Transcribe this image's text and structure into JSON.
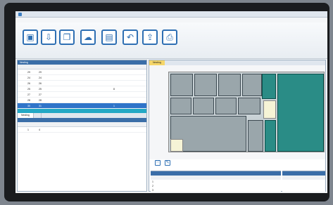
{
  "app": {
    "title": ""
  },
  "menu": {
    "items": [
      "",
      "",
      "",
      "",
      "",
      ""
    ]
  },
  "toolbar": {
    "buttons": [
      {
        "icon": "monitor-icon",
        "glyph": "▣",
        "label": ""
      },
      {
        "icon": "import-icon",
        "glyph": "⇩",
        "label": ""
      },
      {
        "icon": "folder-open-icon",
        "glyph": "❐",
        "label": ""
      },
      {
        "icon": "cloud-icon",
        "glyph": "☁",
        "label": ""
      },
      {
        "icon": "save-icon",
        "glyph": "▤",
        "label": ""
      },
      {
        "icon": "undo-icon",
        "glyph": "↶",
        "label": ""
      },
      {
        "icon": "export-icon",
        "glyph": "⇪",
        "label": ""
      },
      {
        "icon": "print-icon",
        "glyph": "⎙",
        "label": ""
      }
    ]
  },
  "left_panel": {
    "header": "Nesting",
    "columns": [
      "",
      "",
      "",
      "",
      ""
    ],
    "rows": [
      {
        "c1": "",
        "c2": "29",
        "c3": "29",
        "c4": "",
        "c5": ""
      },
      {
        "c1": "",
        "c2": "24",
        "c3": "24",
        "c4": "",
        "c5": ""
      },
      {
        "c1": "",
        "c2": "26",
        "c3": "26",
        "c4": "",
        "c5": ""
      },
      {
        "c1": "",
        "c2": "25",
        "c3": "25",
        "c4": "",
        "c5": "8"
      },
      {
        "c1": "",
        "c2": "27",
        "c3": "27",
        "c4": "",
        "c5": ""
      },
      {
        "c1": "",
        "c2": "28",
        "c3": "28",
        "c4": "",
        "c5": ""
      },
      {
        "c1": "",
        "c2": "30",
        "c3": "31",
        "c4": "",
        "c5": "1"
      }
    ],
    "status": "",
    "tabs": [
      "Nesting",
      ""
    ],
    "sub_header": "",
    "sub_columns": [
      "",
      "",
      "",
      "",
      ""
    ],
    "sub_rows": [
      {
        "c1": "",
        "c2": "1",
        "c3": "4",
        "c4": "",
        "c5": ""
      }
    ]
  },
  "right_panel": {
    "tabs": [
      "Nesting",
      ""
    ],
    "tools": [
      "zoom-icon",
      "edit-icon"
    ],
    "sub_left": {
      "header": "",
      "columns": [
        "",
        "",
        "",
        ""
      ],
      "rows": [
        {
          "s1": "1",
          "s2": "",
          "s3": "",
          "s4": ""
        },
        {
          "s1": "2",
          "s2": "",
          "s3": "",
          "s4": ""
        },
        {
          "s1": "3",
          "s2": "",
          "s3": "",
          "s4": ""
        }
      ]
    },
    "sub_right": {
      "header": "",
      "columns": [
        "",
        "",
        ""
      ]
    }
  },
  "colors": {
    "accent": "#2e6fb3",
    "selection": "#2f74c9",
    "sheet_teal": "#2a8c86",
    "status_cyan": "#23a8c5"
  }
}
